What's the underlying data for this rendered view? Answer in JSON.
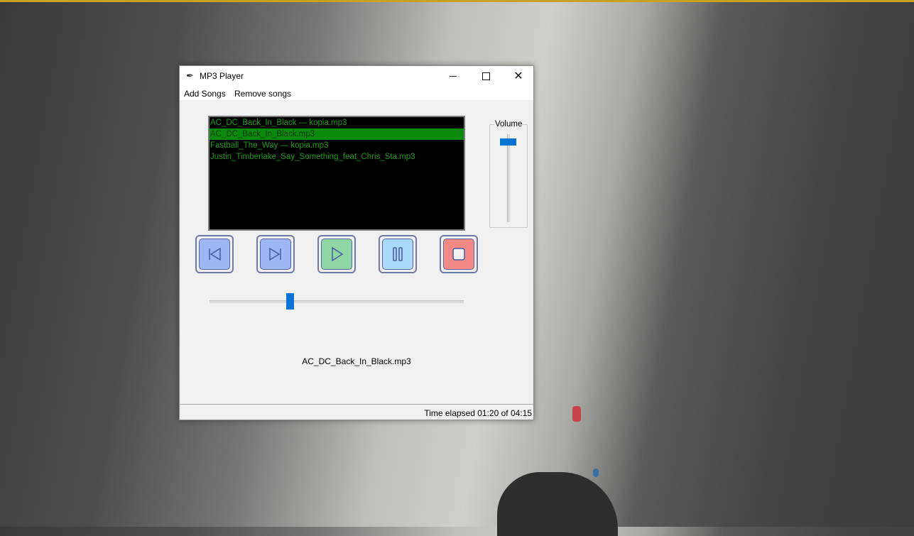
{
  "window": {
    "title": "MP3 Player",
    "controls": {
      "minimize_icon": "minimize-icon",
      "maximize_icon": "maximize-icon",
      "close_icon": "close-icon"
    }
  },
  "menu": {
    "add_songs": "Add Songs",
    "remove_songs": "Remove songs"
  },
  "playlist": {
    "songs": [
      "AC_DC_Back_In_Black — kopia.mp3",
      "AC_DC_Back_In_Black.mp3",
      "Fastball_The_Way — kopia.mp3",
      "Justin_Timberlake_Say_Something_feat_Chris_Sta.mp3"
    ],
    "selected_index": 1
  },
  "volume": {
    "label": "Volume",
    "level": 0.95
  },
  "controls": {
    "previous_icon": "previous-icon",
    "next_icon": "next-icon",
    "play_icon": "play-icon",
    "pause_icon": "pause-icon",
    "stop_icon": "stop-icon"
  },
  "seek": {
    "position": 0.31
  },
  "now_playing": "AC_DC_Back_In_Black.mp3",
  "status": "Time elapsed 01:20 of 04:15",
  "colors": {
    "listbox_bg": "#000000",
    "song_text": "#1f9a1f",
    "selection_bg": "#0b8a0b",
    "slider_thumb": "#0a74d6",
    "prev_next_button": "#9fb6f5",
    "play_button": "#8fd6a3",
    "pause_button": "#a9d8fb",
    "stop_button": "#f48a86"
  }
}
